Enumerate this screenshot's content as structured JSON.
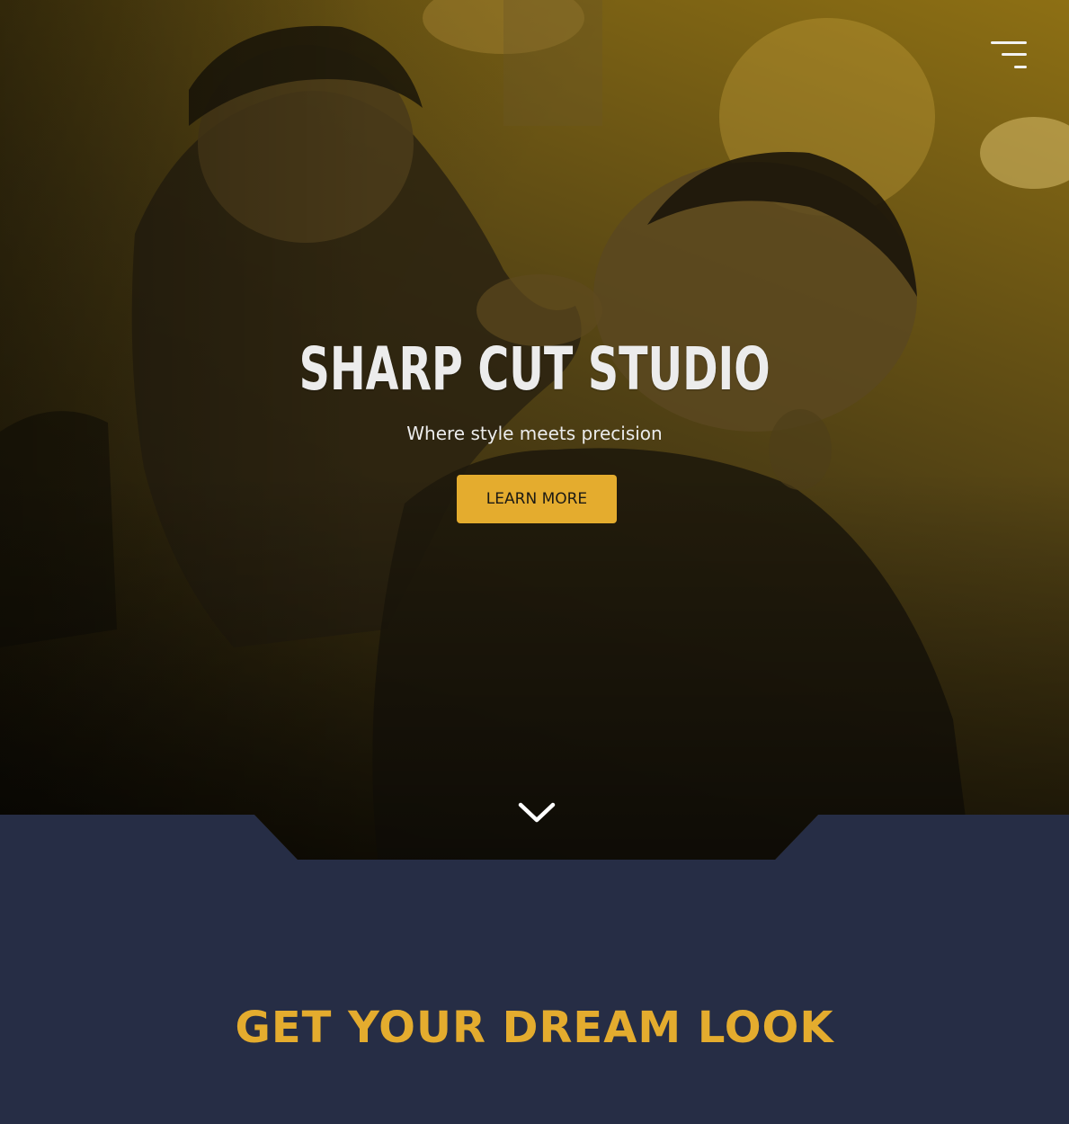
{
  "hero": {
    "title": "SHARP CUT STUDIO",
    "subtitle": "Where style meets precision",
    "cta_label": "LEARN MORE",
    "background_image": "barbershop-photo"
  },
  "nav": {
    "menu_icon": "hamburger-menu-icon"
  },
  "scroll": {
    "icon": "chevron-down-icon"
  },
  "section": {
    "heading": "GET YOUR DREAM LOOK"
  },
  "colors": {
    "accent": "#e4ac2e",
    "background_dark": "#262d45",
    "hero_tint": "#8a6d1a",
    "text_light": "#ececec"
  }
}
